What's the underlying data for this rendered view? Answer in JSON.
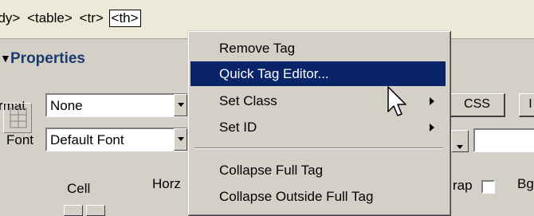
{
  "tag_selector": {
    "tags": [
      "ody>",
      "<table>",
      "<tr>",
      "<th>"
    ]
  },
  "properties": {
    "title": "Properties",
    "format_label": "rmat",
    "format_value": "None",
    "font_label": "Font",
    "font_value": "Default Font",
    "css_button": "CSS",
    "i_button": "I",
    "cell_label": "Cell",
    "horz_label": "Horz",
    "wrap_label": "rap",
    "bg_label": "Bg"
  },
  "context_menu": {
    "items": [
      {
        "label": "Remove Tag",
        "highlighted": false,
        "submenu": false
      },
      {
        "label": "Quick Tag Editor...",
        "highlighted": true,
        "submenu": false
      },
      {
        "label": "Set Class",
        "highlighted": false,
        "submenu": true
      },
      {
        "label": "Set ID",
        "highlighted": false,
        "submenu": true
      },
      {
        "label": "Collapse Full Tag",
        "highlighted": false,
        "submenu": false
      },
      {
        "label": "Collapse Outside Full Tag",
        "highlighted": false,
        "submenu": false
      }
    ]
  },
  "colors": {
    "menu_highlight": "#0a246a",
    "panel": "#d4d0c8",
    "title_text": "#1b3b6f"
  }
}
